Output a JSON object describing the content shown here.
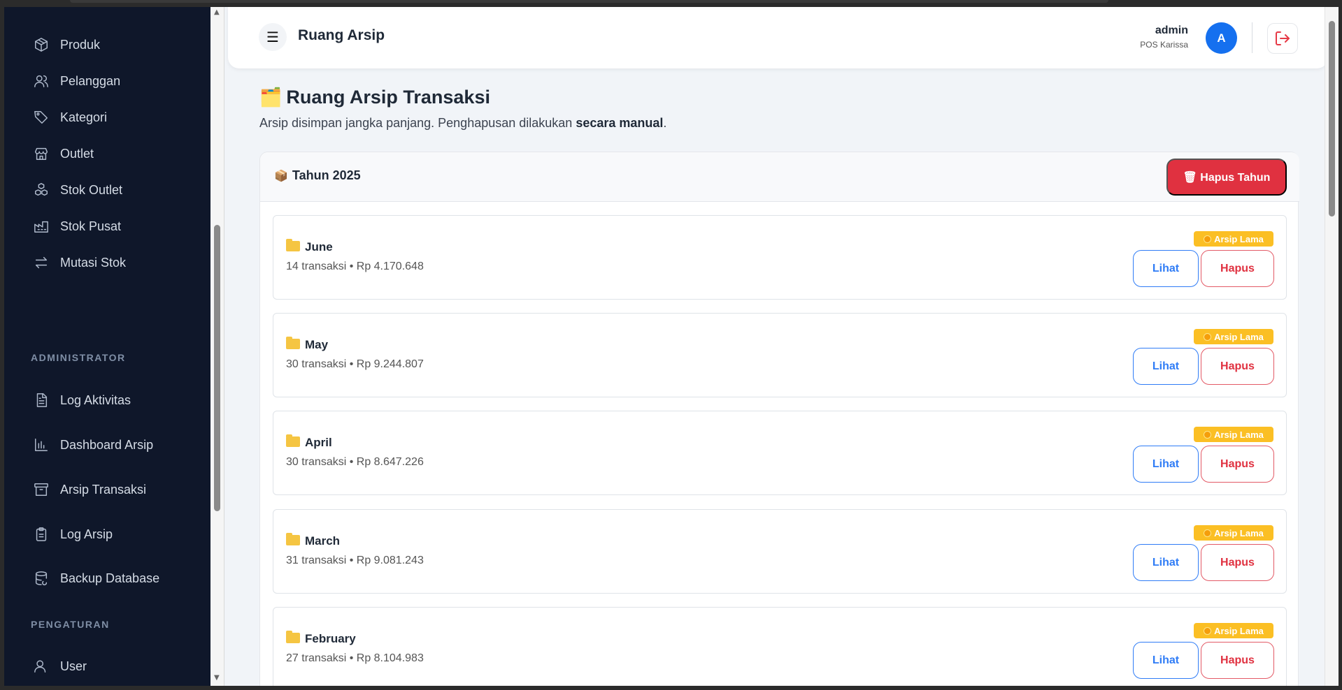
{
  "sidebar": {
    "items": [
      {
        "label": "Produk",
        "icon": "box-icon"
      },
      {
        "label": "Pelanggan",
        "icon": "users-icon"
      },
      {
        "label": "Kategori",
        "icon": "tag-icon"
      },
      {
        "label": "Outlet",
        "icon": "store-icon"
      },
      {
        "label": "Stok Outlet",
        "icon": "boxes-icon"
      },
      {
        "label": "Stok Pusat",
        "icon": "factory-icon"
      },
      {
        "label": "Mutasi Stok",
        "icon": "arrows-exchange-icon"
      }
    ],
    "section_admin": "ADMINISTRATOR",
    "admin_items": [
      {
        "label": "Log Aktivitas",
        "icon": "file-text-icon"
      },
      {
        "label": "Dashboard Arsip",
        "icon": "bar-chart-icon"
      },
      {
        "label": "Arsip Transaksi",
        "icon": "archive-icon"
      },
      {
        "label": "Log Arsip",
        "icon": "clipboard-icon"
      },
      {
        "label": "Backup Database",
        "icon": "database-icon"
      }
    ],
    "section_settings": "PENGATURAN",
    "settings_items": [
      {
        "label": "User",
        "icon": "user-icon"
      }
    ]
  },
  "header": {
    "title": "Ruang Arsip",
    "menu_icon": "☰",
    "user_name": "admin",
    "user_sub": "POS Karissa",
    "avatar_letter": "A"
  },
  "page": {
    "title_emoji": "🗂️",
    "title": "Ruang Arsip Transaksi",
    "subtitle_prefix": "Arsip disimpan jangka panjang. Penghapusan dilakukan ",
    "subtitle_bold": "secara manual",
    "subtitle_suffix": "."
  },
  "year": {
    "emoji": "📦",
    "title": "Tahun 2025",
    "delete_label": "🗑 Hapus Tahun"
  },
  "months": [
    {
      "name": "June",
      "info": "14 transaksi • Rp 4.170.648",
      "badge": "Arsip Lama",
      "view": "Lihat",
      "delete": "Hapus"
    },
    {
      "name": "May",
      "info": "30 transaksi • Rp 9.244.807",
      "badge": "Arsip Lama",
      "view": "Lihat",
      "delete": "Hapus"
    },
    {
      "name": "April",
      "info": "30 transaksi • Rp 8.647.226",
      "badge": "Arsip Lama",
      "view": "Lihat",
      "delete": "Hapus"
    },
    {
      "name": "March",
      "info": "31 transaksi • Rp 9.081.243",
      "badge": "Arsip Lama",
      "view": "Lihat",
      "delete": "Hapus"
    },
    {
      "name": "February",
      "info": "27 transaksi • Rp 8.104.983",
      "badge": "Arsip Lama",
      "view": "Lihat",
      "delete": "Hapus"
    }
  ],
  "colors": {
    "sidebar_bg": "#0f172a",
    "accent_blue": "#2f7cf6",
    "danger_red": "#e03140",
    "badge_yellow": "#fbbf24"
  }
}
